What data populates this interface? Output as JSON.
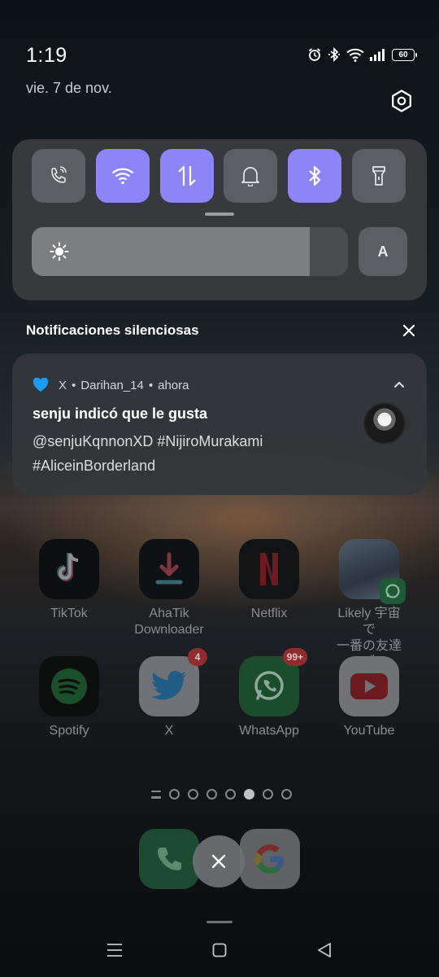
{
  "status_bar": {
    "time": "1:19",
    "date": "vie. 7 de nov.",
    "battery": "60",
    "icons": [
      "alarm-icon",
      "bluetooth-icon",
      "wifi-icon",
      "signal-icon",
      "battery-icon"
    ]
  },
  "quick_settings": {
    "tiles": [
      {
        "name": "wifi-calling",
        "icon": "wifi-call-icon",
        "on": false
      },
      {
        "name": "wifi",
        "icon": "wifi-icon",
        "on": true
      },
      {
        "name": "mobile-data",
        "icon": "data-arrows-icon",
        "on": true
      },
      {
        "name": "sound",
        "icon": "bell-icon",
        "on": false
      },
      {
        "name": "bluetooth",
        "icon": "bluetooth-icon",
        "on": true
      },
      {
        "name": "flashlight",
        "icon": "flashlight-icon",
        "on": false
      }
    ],
    "brightness_level": 0.88,
    "auto_label": "A",
    "accent_color": "#8c84f7"
  },
  "silent_section": {
    "title": "Notificaciones silenciosas"
  },
  "notification": {
    "app": "X",
    "sep1": "•",
    "account": "Darihan_14",
    "sep2": "•",
    "time": "ahora",
    "title": "senju indicó que le gusta",
    "body": "@senjuKqnnonXD #NijiroMurakami #AliceinBorderland"
  },
  "home": {
    "apps": [
      {
        "label": "TikTok",
        "icon": "tiktok-icon"
      },
      {
        "label": "AhaTik\nDownloader",
        "icon": "download-icon"
      },
      {
        "label": "Netflix",
        "icon": "netflix-icon"
      },
      {
        "label": "Likely 宇宙で\n一番の友達👏",
        "icon": "likely-icon"
      },
      {
        "label": "Spotify",
        "icon": "spotify-icon"
      },
      {
        "label": "X",
        "icon": "twitter-icon",
        "badge": "4"
      },
      {
        "label": "WhatsApp",
        "icon": "whatsapp-icon",
        "badge": "99+"
      },
      {
        "label": "YouTube",
        "icon": "youtube-icon"
      }
    ],
    "page_count": 7,
    "active_page": 5
  }
}
